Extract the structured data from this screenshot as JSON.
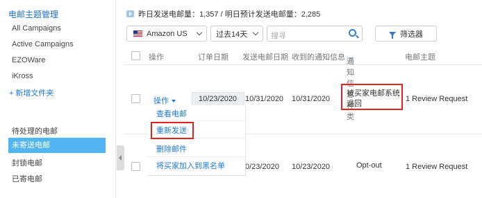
{
  "sidebar": {
    "title": "电邮主题管理",
    "items": [
      {
        "label": "All Campaigns"
      },
      {
        "label": "Active Campaigns"
      },
      {
        "label": "EZOWare"
      },
      {
        "label": "iKross"
      }
    ],
    "new_folder": "新增文件夹",
    "mail_items": [
      {
        "label": "待处理的电邮"
      },
      {
        "label": "未寄送电邮"
      },
      {
        "label": "封锁电邮"
      },
      {
        "label": "已寄电邮"
      }
    ]
  },
  "info_bar": {
    "text": "昨日发送电邮量：1,357 / 明日预计发送电邮量：2,285"
  },
  "toolbar": {
    "marketplace": "Amazon US",
    "date_range": "过去14天",
    "search_placeholder": "搜寻",
    "filter_label": "筛选器"
  },
  "table": {
    "headers": [
      "操作",
      "订单日期",
      "发送电邮日期",
      "收到的通知信息",
      "通知信息种类",
      "电邮主题"
    ],
    "sort_indicator": "↑",
    "rows": [
      {
        "action": "操作",
        "order_date": "10/23/2020",
        "send_date": "10/31/2020",
        "received_date": "10/31/2020",
        "notification_type": "被买家电邮系统退回",
        "subject": "1 Review Request"
      },
      {
        "order_date": "0/23/2020",
        "received_date": "10/23/2020",
        "notification_type": "Opt-out",
        "subject": "1 Review Request"
      }
    ]
  },
  "action_menu": {
    "items": [
      "查看电邮",
      "重新发送",
      "删除邮件",
      "将买家加入到黑名单"
    ]
  },
  "colors": {
    "accent": "#1a78d4",
    "active_sidebar": "#51b6f0",
    "highlight": "#e0231e"
  }
}
